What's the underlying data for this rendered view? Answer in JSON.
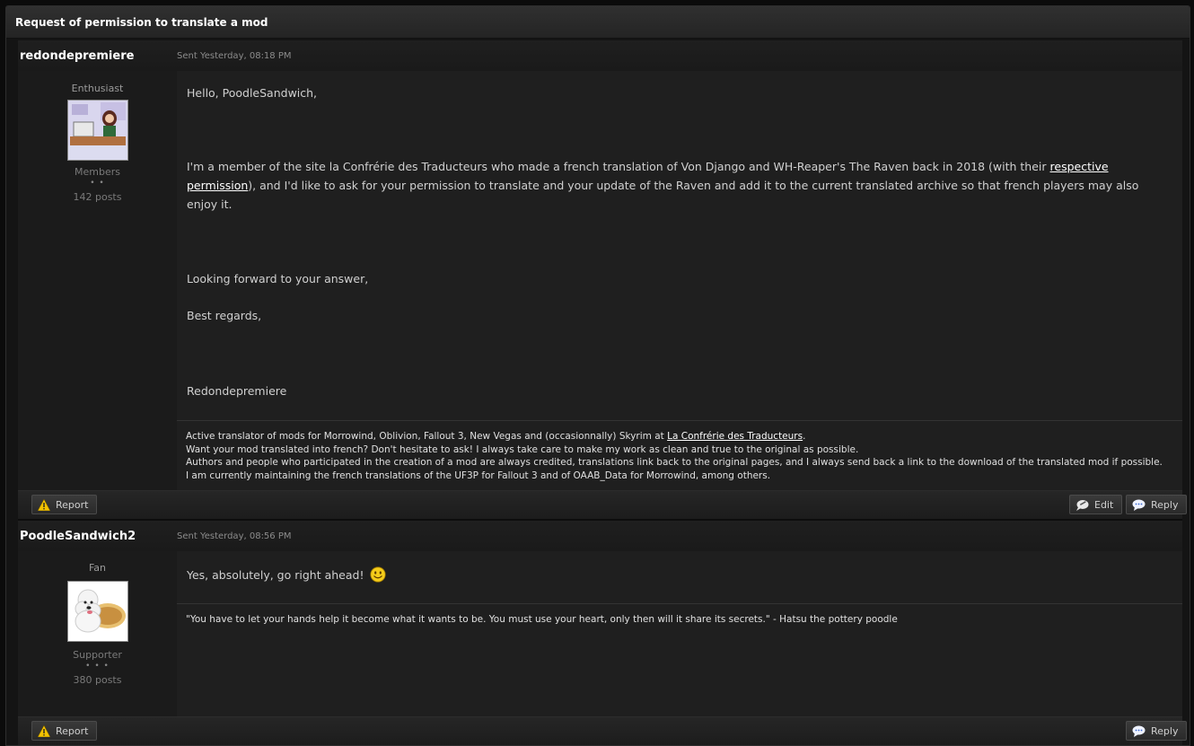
{
  "topic": {
    "title": "Request of permission to translate a mod"
  },
  "posts": [
    {
      "author": "redondepremiere",
      "sent": "Sent Yesterday, 08:18 PM",
      "rank": "Enthusiast",
      "group": "Members",
      "pips": "• •",
      "post_count": "142 posts",
      "greeting": "Hello, PoodleSandwich,",
      "para1_a": "I'm a member of the site la Confrérie des Traducteurs who made a french translation of Von Django and WH-Reaper's The Raven back in 2018 (with their ",
      "para1_link": "respective permission",
      "para1_b": "), and I'd like to ask for your permission to translate and your update of the Raven and add it to the current translated archive so that french players may also enjoy it.",
      "closing1": "Looking forward to your answer,",
      "closing2": "Best regards,",
      "signoff": "Redondepremiere",
      "sig_line1_a": "Active translator of mods for Morrowind, Oblivion, Fallout 3, New Vegas and (occasionnally) Skyrim  at ",
      "sig_line1_link": "La Confrérie des Traducteurs",
      "sig_line1_b": ".",
      "sig_line2": "Want your mod translated into french? Don't hesitate to ask! I always take care to make my work as clean and true to the original as possible.",
      "sig_line3": "Authors and people who participated in the creation of a mod are always credited, translations link back to the original pages, and I always send back a link to the download of the translated mod if possible.",
      "sig_line4": "I am currently maintaining the french translations of the UF3P for Fallout 3 and of OAAB_Data for Morrowind, among others.",
      "report_label": "Report",
      "edit_label": "Edit",
      "reply_label": "Reply"
    },
    {
      "author": "PoodleSandwich2",
      "sent": "Sent Yesterday, 08:56 PM",
      "rank": "Fan",
      "group": "Supporter",
      "pips": "• • •",
      "post_count": "380 posts",
      "message": "Yes, absolutely, go right ahead!",
      "signature": "\"You have to let your hands help it become what it wants to be. You must use your heart, only then will it share its secrets.\" - Hatsu the pottery poodle",
      "report_label": "Report",
      "reply_label": "Reply"
    }
  ],
  "icons": {
    "report": "warning-icon",
    "edit": "edit-icon",
    "reply": "reply-icon",
    "smiley": "smiley-icon"
  }
}
